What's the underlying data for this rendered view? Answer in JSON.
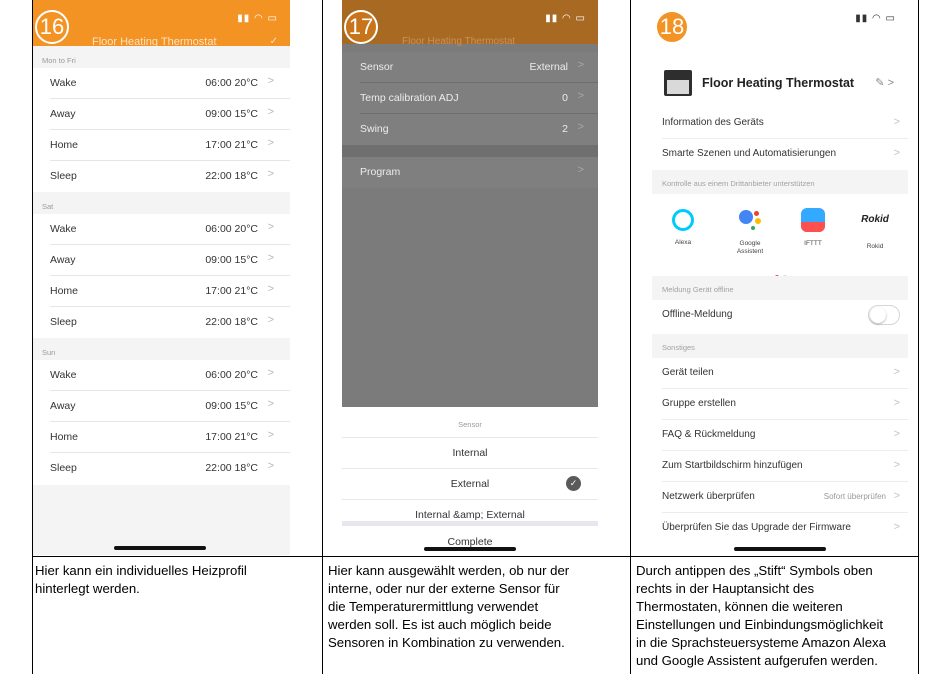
{
  "steps": [
    "16",
    "17",
    "18"
  ],
  "colors": {
    "accent": "#f39323",
    "overlay": "#7b7b7b"
  },
  "panel1": {
    "header_title": "Floor Heating Thermostat",
    "header_action": "✓",
    "sections": [
      {
        "title": "Mon to Fri",
        "rows": [
          {
            "label": "Wake",
            "value": "06:00  20°C"
          },
          {
            "label": "Away",
            "value": "09:00  15°C"
          },
          {
            "label": "Home",
            "value": "17:00  21°C"
          },
          {
            "label": "Sleep",
            "value": "22:00  18°C"
          }
        ]
      },
      {
        "title": "Sat",
        "rows": [
          {
            "label": "Wake",
            "value": "06:00  20°C"
          },
          {
            "label": "Away",
            "value": "09:00  15°C"
          },
          {
            "label": "Home",
            "value": "17:00  21°C"
          },
          {
            "label": "Sleep",
            "value": "22:00  18°C"
          }
        ]
      },
      {
        "title": "Sun",
        "rows": [
          {
            "label": "Wake",
            "value": "06:00  20°C"
          },
          {
            "label": "Away",
            "value": "09:00  15°C"
          },
          {
            "label": "Home",
            "value": "17:00  21°C"
          },
          {
            "label": "Sleep",
            "value": "22:00  18°C"
          }
        ]
      }
    ]
  },
  "panel2": {
    "header_title": "Floor Heating Thermostat",
    "rows": [
      {
        "label": "Sensor",
        "value": "External"
      },
      {
        "label": "Temp calibration ADJ",
        "value": "0"
      },
      {
        "label": "Swing",
        "value": "2"
      }
    ],
    "program_label": "Program",
    "sheet": {
      "title": "Sensor",
      "options": [
        "Internal",
        "External",
        "Internal &amp; External"
      ],
      "selected": "External",
      "complete": "Complete"
    }
  },
  "panel3": {
    "device_name": "Floor Heating Thermostat",
    "rows_top": [
      {
        "label": "Information des Geräts"
      },
      {
        "label": "Smarte Szenen und Automatisierungen"
      }
    ],
    "third_party_title": "Kontrolle aus einem Drittanbieter unterstützen",
    "services": [
      {
        "name": "Alexa",
        "icon": "alexa-icon",
        "color": "#00caff"
      },
      {
        "name": "Google\nAssistent",
        "icon": "google-assistant-icon",
        "color": "#4285f4"
      },
      {
        "name": "IFTTT",
        "icon": "ifttt-icon",
        "color": "#33aaff"
      },
      {
        "name": "Rokid",
        "icon": "rokid-icon",
        "color": "#222222"
      }
    ],
    "offline_section": "Meldung Gerät offline",
    "offline_label": "Offline-Meldung",
    "misc_section": "Sonstiges",
    "rows_misc": [
      {
        "label": "Gerät teilen",
        "value": ""
      },
      {
        "label": "Gruppe erstellen",
        "value": ""
      },
      {
        "label": "FAQ & Rückmeldung",
        "value": ""
      },
      {
        "label": "Zum Startbildschirm hinzufügen",
        "value": ""
      },
      {
        "label": "Netzwerk überprüfen",
        "value": "Sofort überprüfen"
      },
      {
        "label": "Überprüfen Sie das Upgrade der Firmware",
        "value": ""
      }
    ]
  },
  "captions": [
    "Hier kann ein individuelles Heizprofil\nhinterlegt werden.",
    "Hier kann ausgewählt werden, ob nur der\ninterne, oder nur der externe Sensor für\ndie Temperaturermittlung verwendet\nwerden soll. Es ist auch möglich beide\nSensoren in Kombination zu verwenden.",
    "Durch antippen des „Stift“ Symbols oben\nrechts in der Hauptansicht des\nThermostaten, können die weiteren\nEinstellungen und Einbindungsmöglichkeit\nin die Sprachsteuersysteme Amazon Alexa\nund Google Assistent aufgerufen werden."
  ]
}
